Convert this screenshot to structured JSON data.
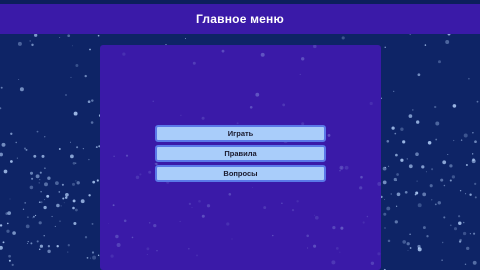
{
  "header": {
    "title": "Главное меню"
  },
  "menu": {
    "items": [
      {
        "label": "Играть"
      },
      {
        "label": "Правила"
      },
      {
        "label": "Вопросы"
      }
    ]
  },
  "colors": {
    "background": "#0e2466",
    "header": "#3a1aa8",
    "panel": "#3a1aa8",
    "button": "#a9cdfa",
    "button_border": "#5a78e8",
    "particles": "#b9d6ff"
  }
}
